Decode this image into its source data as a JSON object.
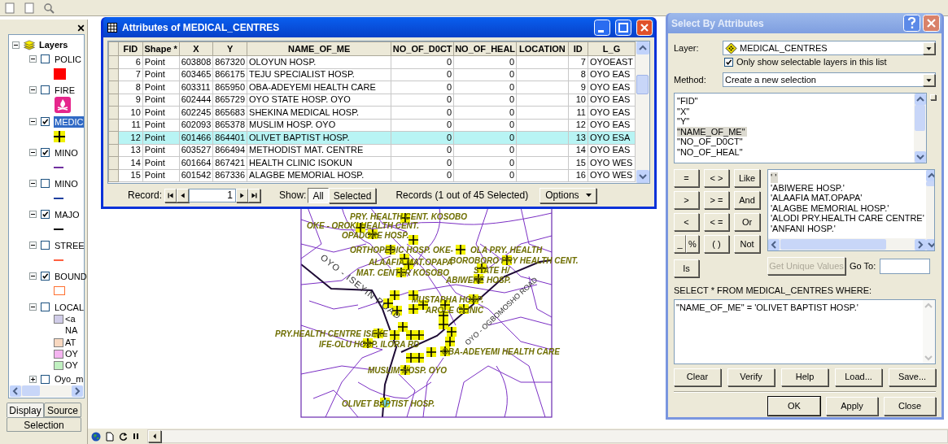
{
  "toc": {
    "title": "Layers",
    "layers": [
      {
        "label": "POLIC",
        "checked": false,
        "expanded": true,
        "selected": false,
        "symbol": {
          "kind": "fill",
          "color": "#ff0000"
        }
      },
      {
        "label": "FIRE",
        "checked": false,
        "expanded": true,
        "selected": false,
        "symbol": {
          "kind": "fire",
          "color": "#e6268c"
        }
      },
      {
        "label": "MEDIC",
        "checked": true,
        "expanded": true,
        "selected": true,
        "symbol": {
          "kind": "cross",
          "color": "#f0f000"
        }
      },
      {
        "label": "MINO",
        "checked": true,
        "expanded": true,
        "selected": false,
        "symbol": {
          "kind": "line",
          "color": "#7030a0"
        }
      },
      {
        "label": "MINO",
        "checked": false,
        "expanded": true,
        "selected": false,
        "symbol": {
          "kind": "line",
          "color": "#2040a0"
        }
      },
      {
        "label": "MAJO",
        "checked": true,
        "expanded": true,
        "selected": false,
        "symbol": {
          "kind": "line",
          "color": "#000000"
        }
      },
      {
        "label": "STREE",
        "checked": false,
        "expanded": true,
        "selected": false,
        "symbol": {
          "kind": "line",
          "color": "#ff6040"
        }
      },
      {
        "label": "BOUND",
        "checked": true,
        "expanded": true,
        "selected": false,
        "symbol": {
          "kind": "outline",
          "color": "#ff7030"
        }
      },
      {
        "label": "LOCAL",
        "checked": false,
        "expanded": true,
        "selected": false,
        "classes": [
          {
            "label": "<a",
            "color": "#d0cce8"
          },
          {
            "label": "NA"
          },
          {
            "label": "AT",
            "color": "#f8d8c0"
          },
          {
            "label": "OY",
            "color": "#f4b4f0"
          },
          {
            "label": "OY",
            "color": "#c0f0c0"
          }
        ]
      },
      {
        "label": "Oyo_m",
        "checked": false,
        "expanded": false,
        "selected": false
      }
    ],
    "tabs": [
      {
        "label": "Display",
        "selected": true
      },
      {
        "label": "Source",
        "selected": false
      },
      {
        "label": "Selection",
        "selected": false
      }
    ]
  },
  "attributes": {
    "title": "Attributes of MEDICAL_CENTRES",
    "columns": [
      "FID",
      "Shape *",
      "X",
      "Y",
      "NAME_OF_ME",
      "NO_OF_D0CT",
      "NO_OF_HEAL",
      "LOCATION",
      "ID",
      "L_G"
    ],
    "rows": [
      {
        "selected": false,
        "cells": [
          "6",
          "Point",
          "603808",
          "867320",
          "OLOYUN HOSP.",
          "0",
          "0",
          "",
          "7",
          "OYOEAST"
        ]
      },
      {
        "selected": false,
        "cells": [
          "7",
          "Point",
          "603465",
          "866175",
          "TEJU SPECIALIST HOSP.",
          "0",
          "0",
          "",
          "8",
          "OYO EAS"
        ]
      },
      {
        "selected": false,
        "cells": [
          "8",
          "Point",
          "603311",
          "865950",
          "OBA-ADEYEMI HEALTH CARE",
          "0",
          "0",
          "",
          "9",
          "OYO EAS"
        ]
      },
      {
        "selected": false,
        "cells": [
          "9",
          "Point",
          "602444",
          "865729",
          "OYO STATE HOSP. OYO",
          "0",
          "0",
          "",
          "10",
          "OYO EAS"
        ]
      },
      {
        "selected": false,
        "cells": [
          "10",
          "Point",
          "602245",
          "865683",
          "SHEKINA MEDICAL HOSP.",
          "0",
          "0",
          "",
          "11",
          "OYO EAS"
        ]
      },
      {
        "selected": false,
        "cells": [
          "11",
          "Point",
          "602093",
          "865378",
          "MUSLIM HOSP. OYO",
          "0",
          "0",
          "",
          "12",
          "OYO EAS"
        ]
      },
      {
        "selected": true,
        "cells": [
          "12",
          "Point",
          "601466",
          "864401",
          "OLIVET BAPTIST HOSP.",
          "0",
          "0",
          "",
          "13",
          "OYO ESA"
        ]
      },
      {
        "selected": false,
        "cells": [
          "13",
          "Point",
          "603527",
          "866494",
          "METHODIST MAT. CENTRE",
          "0",
          "0",
          "",
          "14",
          "OYO EAS"
        ]
      },
      {
        "selected": false,
        "cells": [
          "14",
          "Point",
          "601664",
          "867421",
          "HEALTH CLINIC ISOKUN",
          "0",
          "0",
          "",
          "15",
          "OYO WES"
        ]
      },
      {
        "selected": false,
        "cells": [
          "15",
          "Point",
          "601542",
          "867336",
          "ALAGBE MEMORIAL HOSP.",
          "0",
          "0",
          "",
          "16",
          "OYO WES"
        ]
      }
    ],
    "record_label": "Record:",
    "record_value": "1",
    "show_label": "Show:",
    "show_buttons": [
      {
        "label": "All",
        "selected": true
      },
      {
        "label": "Selected",
        "selected": false
      }
    ],
    "status": "Records (1 out of 45 Selected)",
    "options": "Options"
  },
  "map": {
    "labels": [
      "PRY. HEALTH CENT. KOSOBO",
      "OKE - OROKI HEALTH CENT.",
      "OPADORE HOSP.",
      "ORTHOPEDIC HOSP. OKE-",
      "OLA PRY. HEALTH",
      "ALAAFIA MAT.OPAPA",
      "BOROBORO PRY HEALTH CENT.",
      "STATE H/",
      "MAT. CENTER KOSOBO",
      "ABIWERE HOSP.",
      "MUSTAPHA HOSP.",
      "AROLE CLINIC",
      "PRY.HEALTH CENTRE ISEKE",
      "IFE-OLU HOSP. ILORA RD",
      "OBA-ADEYEMI HEALTH CARE",
      "MUSLIM HOSP. OYO",
      "OLIVET BAPTIST HOSP."
    ],
    "roads": [
      "OYO - ISEYIN ROAD",
      "OYO - OGBOMOSHO ROAD"
    ]
  },
  "dialog": {
    "title": "Select By Attributes",
    "layer_label": "Layer:",
    "layer_value": "MEDICAL_CENTRES",
    "only_selectable": {
      "label": "Only show selectable layers in this list",
      "checked": true
    },
    "method_label": "Method:",
    "method_value": "Create a new selection",
    "fields": [
      {
        "label": "\"FID\"",
        "selected": false
      },
      {
        "label": "\"X\"",
        "selected": false
      },
      {
        "label": "\"Y\"",
        "selected": false
      },
      {
        "label": "\"NAME_OF_ME\"",
        "selected": true
      },
      {
        "label": "\"NO_OF_D0CT\"",
        "selected": false
      },
      {
        "label": "\"NO_OF_HEAL\"",
        "selected": false
      }
    ],
    "operators": [
      [
        "=",
        "< >",
        "Like"
      ],
      [
        ">",
        "> =",
        "And"
      ],
      [
        "<",
        "< =",
        "Or"
      ],
      [
        "_",
        "%",
        "( )",
        "Not"
      ],
      [
        "Is"
      ]
    ],
    "values": [
      {
        "label": "' '",
        "selected": true
      },
      {
        "label": "'ABIWERE HOSP.'",
        "selected": false
      },
      {
        "label": "'ALAAFIA MAT.OPAPA'",
        "selected": false
      },
      {
        "label": "'ALAGBE MEMORIAL HOSP.'",
        "selected": false
      },
      {
        "label": "'ALODI PRY.HEALTH CARE CENTRE'",
        "selected": false
      },
      {
        "label": "'ANFANI HOSP.'",
        "selected": false
      }
    ],
    "unique_button": {
      "label": "Get Unique Values",
      "disabled": true
    },
    "goto_label": "Go To:",
    "query_label": "SELECT * FROM MEDICAL_CENTRES WHERE:",
    "query": "\"NAME_OF_ME\" = 'OLIVET BAPTIST HOSP.'",
    "buttons": [
      "Clear",
      "Verify",
      "Help",
      "Load...",
      "Save..."
    ],
    "footer_buttons": [
      "OK",
      "Apply",
      "Close"
    ]
  }
}
